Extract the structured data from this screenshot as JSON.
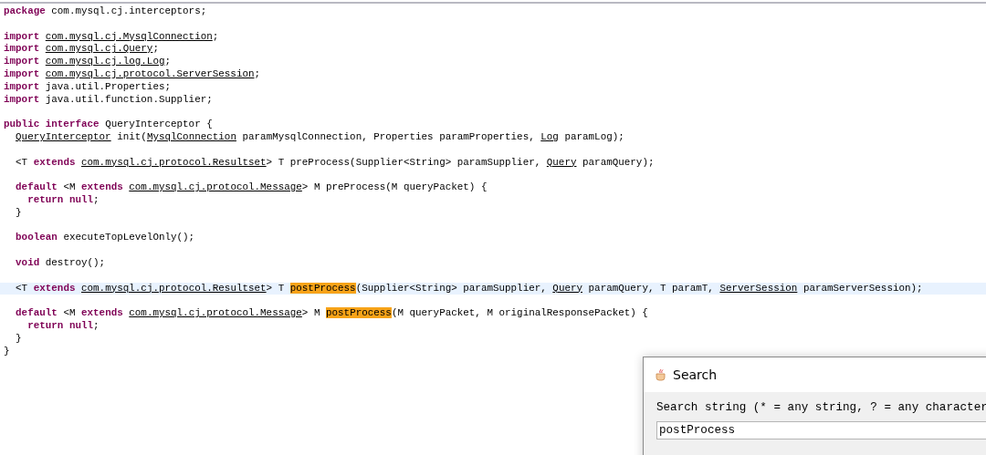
{
  "editor": {
    "lines": [
      {
        "kind": "code",
        "current": false,
        "tokens": [
          {
            "kind": "keyword",
            "text": "package"
          },
          {
            "kind": "plain",
            "text": " com.mysql.cj.interceptors;"
          }
        ]
      },
      {
        "kind": "blank"
      },
      {
        "kind": "code",
        "current": false,
        "tokens": [
          {
            "kind": "keyword",
            "text": "import "
          },
          {
            "kind": "link",
            "text": "com.mysql.cj.MysqlConnection"
          },
          {
            "kind": "plain",
            "text": ";"
          }
        ]
      },
      {
        "kind": "code",
        "current": false,
        "tokens": [
          {
            "kind": "keyword",
            "text": "import "
          },
          {
            "kind": "link",
            "text": "com.mysql.cj.Query"
          },
          {
            "kind": "plain",
            "text": ";"
          }
        ]
      },
      {
        "kind": "code",
        "current": false,
        "tokens": [
          {
            "kind": "keyword",
            "text": "import "
          },
          {
            "kind": "link",
            "text": "com.mysql.cj.log.Log"
          },
          {
            "kind": "plain",
            "text": ";"
          }
        ]
      },
      {
        "kind": "code",
        "current": false,
        "tokens": [
          {
            "kind": "keyword",
            "text": "import "
          },
          {
            "kind": "link",
            "text": "com.mysql.cj.protocol.ServerSession"
          },
          {
            "kind": "plain",
            "text": ";"
          }
        ]
      },
      {
        "kind": "code",
        "current": false,
        "tokens": [
          {
            "kind": "keyword",
            "text": "import"
          },
          {
            "kind": "plain",
            "text": " java.util.Properties;"
          }
        ]
      },
      {
        "kind": "code",
        "current": false,
        "tokens": [
          {
            "kind": "keyword",
            "text": "import"
          },
          {
            "kind": "plain",
            "text": " java.util.function.Supplier;"
          }
        ]
      },
      {
        "kind": "blank"
      },
      {
        "kind": "code",
        "current": false,
        "tokens": [
          {
            "kind": "keyword",
            "text": "public interface"
          },
          {
            "kind": "plain",
            "text": " QueryInterceptor {"
          }
        ]
      },
      {
        "kind": "code",
        "current": false,
        "tokens": [
          {
            "kind": "link",
            "text": "  QueryInterceptor"
          },
          {
            "kind": "plain",
            "text": " init("
          },
          {
            "kind": "link",
            "text": "MysqlConnection"
          },
          {
            "kind": "plain",
            "text": " paramMysqlConnection, Properties paramProperties, "
          },
          {
            "kind": "link",
            "text": "Log"
          },
          {
            "kind": "plain",
            "text": " paramLog);"
          }
        ]
      },
      {
        "kind": "blank"
      },
      {
        "kind": "code",
        "current": false,
        "tokens": [
          {
            "kind": "plain",
            "text": "  <T "
          },
          {
            "kind": "keyword",
            "text": "extends "
          },
          {
            "kind": "link",
            "text": "com.mysql.cj.protocol.Resultset"
          },
          {
            "kind": "plain",
            "text": "> T preProcess(Supplier<String> paramSupplier, "
          },
          {
            "kind": "link",
            "text": "Query"
          },
          {
            "kind": "plain",
            "text": " paramQuery);"
          }
        ]
      },
      {
        "kind": "blank"
      },
      {
        "kind": "code",
        "current": false,
        "tokens": [
          {
            "kind": "keyword",
            "text": "  default"
          },
          {
            "kind": "plain",
            "text": " <M "
          },
          {
            "kind": "keyword",
            "text": "extends "
          },
          {
            "kind": "link",
            "text": "com.mysql.cj.protocol.Message"
          },
          {
            "kind": "plain",
            "text": "> M preProcess(M queryPacket) {"
          }
        ]
      },
      {
        "kind": "code",
        "current": false,
        "tokens": [
          {
            "kind": "keyword",
            "text": "    return null"
          },
          {
            "kind": "plain",
            "text": ";"
          }
        ]
      },
      {
        "kind": "code",
        "current": false,
        "tokens": [
          {
            "kind": "plain",
            "text": "  }"
          }
        ]
      },
      {
        "kind": "blank"
      },
      {
        "kind": "code",
        "current": false,
        "tokens": [
          {
            "kind": "keyword",
            "text": "  boolean"
          },
          {
            "kind": "plain",
            "text": " executeTopLevelOnly();"
          }
        ]
      },
      {
        "kind": "blank"
      },
      {
        "kind": "code",
        "current": false,
        "tokens": [
          {
            "kind": "keyword",
            "text": "  void"
          },
          {
            "kind": "plain",
            "text": " destroy();"
          }
        ]
      },
      {
        "kind": "blank"
      },
      {
        "kind": "code",
        "current": true,
        "tokens": [
          {
            "kind": "plain",
            "text": "  <T "
          },
          {
            "kind": "keyword",
            "text": "extends "
          },
          {
            "kind": "link",
            "text": "com.mysql.cj.protocol.Resultset"
          },
          {
            "kind": "plain",
            "text": "> T "
          },
          {
            "kind": "match",
            "text": "postProcess"
          },
          {
            "kind": "plain",
            "text": "(Supplier<String> paramSupplier, "
          },
          {
            "kind": "link",
            "text": "Query"
          },
          {
            "kind": "plain",
            "text": " paramQuery, T paramT, "
          },
          {
            "kind": "link",
            "text": "ServerSession"
          },
          {
            "kind": "plain",
            "text": " paramServerSession);"
          }
        ]
      },
      {
        "kind": "blank"
      },
      {
        "kind": "code",
        "current": false,
        "tokens": [
          {
            "kind": "keyword",
            "text": "  default"
          },
          {
            "kind": "plain",
            "text": " <M "
          },
          {
            "kind": "keyword",
            "text": "extends "
          },
          {
            "kind": "link",
            "text": "com.mysql.cj.protocol.Message"
          },
          {
            "kind": "plain",
            "text": "> M "
          },
          {
            "kind": "match",
            "text": "postProcess"
          },
          {
            "kind": "plain",
            "text": "(M queryPacket, M originalResponsePacket) {"
          }
        ]
      },
      {
        "kind": "code",
        "current": false,
        "tokens": [
          {
            "kind": "keyword",
            "text": "    return null"
          },
          {
            "kind": "plain",
            "text": ";"
          }
        ]
      },
      {
        "kind": "code",
        "current": false,
        "tokens": [
          {
            "kind": "plain",
            "text": "  }"
          }
        ]
      },
      {
        "kind": "code",
        "current": false,
        "tokens": [
          {
            "kind": "plain",
            "text": "}"
          }
        ]
      }
    ]
  },
  "search_dialog": {
    "title": "Search",
    "label": "Search string (* = any string, ? = any character",
    "value": "postProcess"
  }
}
